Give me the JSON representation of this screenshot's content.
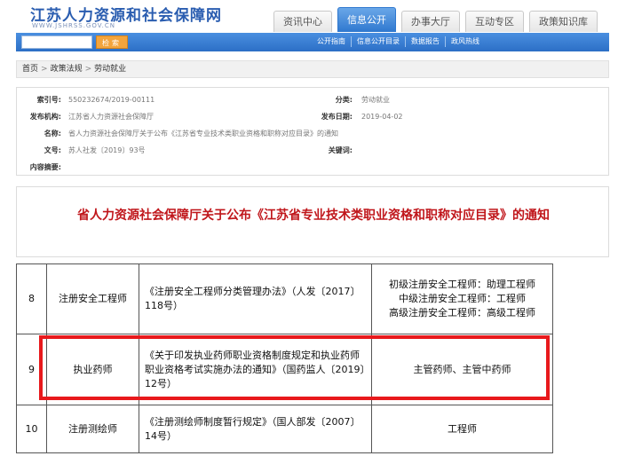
{
  "header": {
    "title": "江苏人力资源和社会保障网",
    "subtitle": "WWW.JSHRSS.GOV.CN"
  },
  "nav": {
    "tabs": [
      {
        "label": "资讯中心",
        "active": false
      },
      {
        "label": "信息公开",
        "active": true
      },
      {
        "label": "办事大厅",
        "active": false
      },
      {
        "label": "互动专区",
        "active": false
      },
      {
        "label": "政策知识库",
        "active": false
      }
    ]
  },
  "search": {
    "placeholder": "",
    "button": "检索"
  },
  "sublinks": [
    "公开指南",
    "信息公开目录",
    "数据报告",
    "政风热线"
  ],
  "breadcrumb": [
    "首页",
    "政策法规",
    "劳动就业"
  ],
  "meta": {
    "index_label": "索引号:",
    "index_value": "550232674/2019-00111",
    "category_label": "分类:",
    "category_value": "劳动就业",
    "publisher_label": "发布机构:",
    "publisher_value": "江苏省人力资源社会保障厅",
    "date_label": "发布日期:",
    "date_value": "2019-04-02",
    "name_label": "名称:",
    "name_value": "省人力资源社会保障厅关于公布《江苏省专业技术类职业资格和职称对应目录》的通知",
    "docno_label": "文号:",
    "docno_value": "苏人社发〔2019〕93号",
    "keywords_label": "关键词:",
    "keywords_value": "",
    "summary_label": "内容摘要:",
    "summary_value": ""
  },
  "article": {
    "title": "省人力资源社会保障厅关于公布《江苏省专业技术类职业资格和职称对应目录》的通知"
  },
  "table": {
    "rows": [
      {
        "no": "8",
        "name": "注册安全工程师",
        "basis": "《注册安全工程师分类管理办法》（人发〔2017〕118号）",
        "titles": [
          "初级注册安全工程师：助理工程师",
          "中级注册安全工程师：工程师",
          "高级注册安全工程师：高级工程师"
        ]
      },
      {
        "no": "9",
        "name": "执业药师",
        "basis": "《关于印发执业药师职业资格制度规定和执业药师职业资格考试实施办法的通知》（国药监人〔2019〕12号）",
        "titles": [
          "主管药师、主管中药师"
        ]
      },
      {
        "no": "10",
        "name": "注册测绘师",
        "basis": "《注册测绘师制度暂行规定》（国人部发〔2007〕14号）",
        "titles": [
          "工程师"
        ]
      }
    ]
  },
  "colors": {
    "brand_blue": "#2f78cf",
    "title_red": "#c0161b",
    "highlight_red": "#e8191c"
  }
}
